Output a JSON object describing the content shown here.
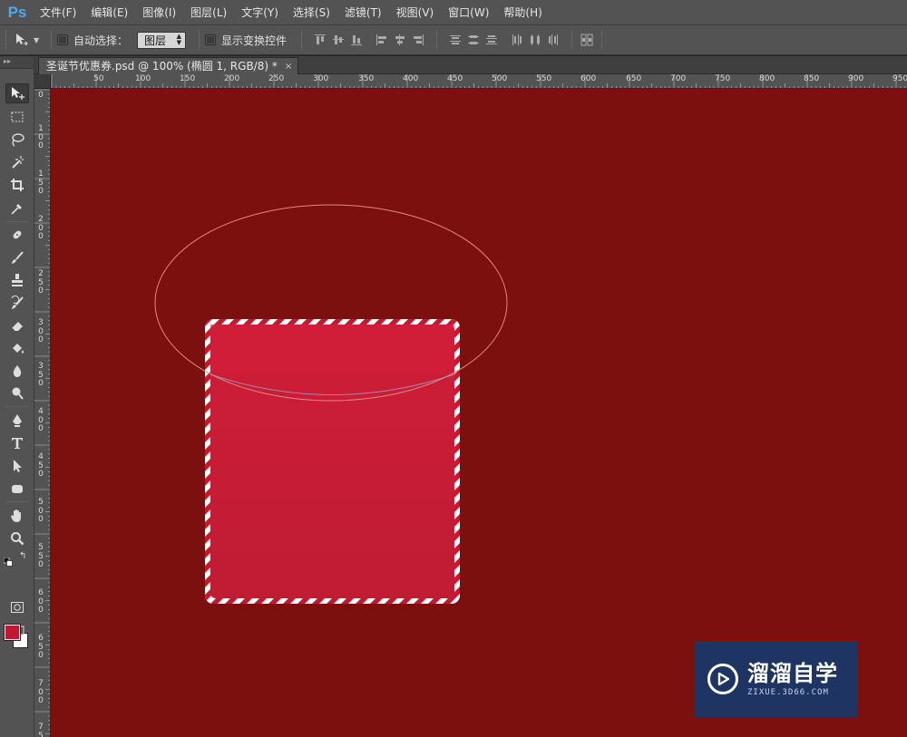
{
  "app": {
    "logo": "Ps",
    "menu": [
      "文件(F)",
      "编辑(E)",
      "图像(I)",
      "图层(L)",
      "文字(Y)",
      "选择(S)",
      "滤镜(T)",
      "视图(V)",
      "窗口(W)",
      "帮助(H)"
    ]
  },
  "options": {
    "auto_select_label": "自动选择：",
    "auto_select_target": "图层",
    "show_transform_label": "显示变换控件"
  },
  "document": {
    "tab_title": "圣诞节优惠券.psd @ 100% (椭圆 1, RGB/8) *",
    "close_glyph": "×"
  },
  "rulers": {
    "horizontal": [
      "50",
      "100",
      "150",
      "200",
      "250",
      "300",
      "350",
      "400",
      "450",
      "500",
      "550",
      "600",
      "650",
      "700",
      "750",
      "800",
      "850",
      "900",
      "950"
    ],
    "vertical": [
      "0",
      "1 0 0",
      "1 5 0",
      "2 0 0",
      "2 5 0",
      "3 0 0",
      "3 5 0",
      "4 0 0",
      "4 5 0",
      "5 0 0",
      "5 5 0",
      "6 0 0",
      "6 5 0",
      "7 0 0",
      "7 5"
    ]
  },
  "colors": {
    "canvas": "#7b100f",
    "card": "#c41e36",
    "foreground": "#c0182f",
    "background": "#ffffff",
    "ellipse_stroke": "#e08a82"
  },
  "tools": [
    "move-icon",
    "marquee-icon",
    "lasso-icon",
    "magic-wand-icon",
    "crop-icon",
    "eyedropper-icon",
    "healing-brush-icon",
    "brush-icon",
    "stamp-icon",
    "history-brush-icon",
    "eraser-icon",
    "paint-bucket-icon",
    "blur-icon",
    "dodge-icon",
    "pen-icon",
    "type-icon",
    "path-select-icon",
    "shape-icon",
    "hand-icon",
    "zoom-icon"
  ],
  "watermark": {
    "title": "溜溜自学",
    "subtitle": "ZIXUE.3D66.COM"
  }
}
